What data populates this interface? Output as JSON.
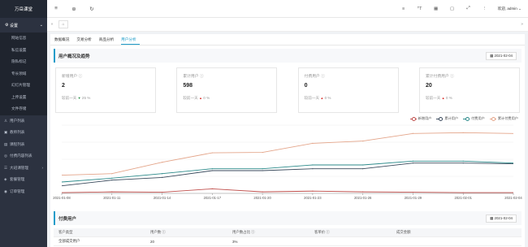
{
  "app": {
    "logo": "万岳课堂"
  },
  "sidebar": {
    "group": {
      "label": "设置",
      "icon": "gear-icon"
    },
    "sub_items": [
      "网站信息",
      "私信设置",
      "隐私标记",
      "专长领域",
      "幻灯片管理",
      "上传设置",
      "文件存储"
    ],
    "nav_items": [
      {
        "label": "用户列表",
        "icon": "user-icon",
        "expand": false
      },
      {
        "label": "教师列表",
        "icon": "teacher-icon",
        "expand": false
      },
      {
        "label": "课程列表",
        "icon": "course-icon",
        "expand": false
      },
      {
        "label": "付费内容列表",
        "icon": "pay-content-icon",
        "expand": false
      },
      {
        "label": "大班课管理",
        "icon": "class-icon",
        "expand": true
      },
      {
        "label": "套餐管理",
        "icon": "package-icon",
        "expand": false
      },
      {
        "label": "订单管理",
        "icon": "order-icon",
        "expand": false
      }
    ]
  },
  "topbar": {
    "icons": [
      "menu-icon",
      "globe-icon",
      "refresh-icon"
    ],
    "right_icons": [
      "align-icon",
      "font-size-icon",
      "theme-icon",
      "lock-icon",
      "fullscreen-icon",
      "more-icon"
    ],
    "welcome": "欢迎, admin ⌄"
  },
  "tabs": [
    "数据概况",
    "交易分析",
    "商品分析",
    "用户分析"
  ],
  "active_tab": 3,
  "overview": {
    "title": "用户概况及趋势",
    "date": "2021-02-04",
    "cards": [
      {
        "label": "新增用户 ⓘ",
        "value": "2",
        "compare": "较前一天",
        "trend": "down",
        "percent": "25 %"
      },
      {
        "label": "累计用户 ⓘ",
        "value": "598",
        "compare": "较前一天",
        "trend": "up",
        "percent": "0 %"
      },
      {
        "label": "付费用户 ⓘ",
        "value": "0",
        "compare": "较前一天",
        "trend": "up",
        "percent": "0 %"
      },
      {
        "label": "累计付费用户 ⓘ",
        "value": "20",
        "compare": "较前一天",
        "trend": "up",
        "percent": "0 %"
      }
    ]
  },
  "chart_data": {
    "type": "line",
    "x": [
      "2021-01-08",
      "2021-01-11",
      "2021-01-14",
      "2021-01-17",
      "2021-01-20",
      "2021-01-23",
      "2021-01-26",
      "2021-01-29",
      "2021-02-01",
      "2021-02-04"
    ],
    "ylim": [
      0,
      180
    ],
    "grid": true,
    "legend": "top-right",
    "series": [
      {
        "name": "新增用户",
        "color": "#c0504d",
        "values": [
          2,
          4,
          3,
          12,
          4,
          6,
          4,
          3,
          2,
          2
        ]
      },
      {
        "name": "累计用户",
        "color": "#3a4a5c",
        "values": [
          20,
          35,
          42,
          60,
          60,
          65,
          65,
          80,
          80,
          78
        ]
      },
      {
        "name": "付费用户",
        "color": "#2b8a8a",
        "values": [
          30,
          40,
          52,
          65,
          65,
          75,
          75,
          85,
          85,
          80
        ]
      },
      {
        "name": "累计付费用户",
        "color": "#e4a58a",
        "values": [
          48,
          52,
          82,
          107,
          108,
          132,
          138,
          158,
          160,
          158
        ]
      }
    ]
  },
  "paid": {
    "title": "付费用户",
    "date": "2021-02-04",
    "headers": [
      "客户类型",
      "用户数 ⓘ",
      "用户数占比 ⓘ",
      "客单价 ⓘ",
      "成交金额"
    ],
    "rows": [
      [
        "全部成交用户",
        "20",
        "3%",
        "",
        ""
      ]
    ]
  }
}
